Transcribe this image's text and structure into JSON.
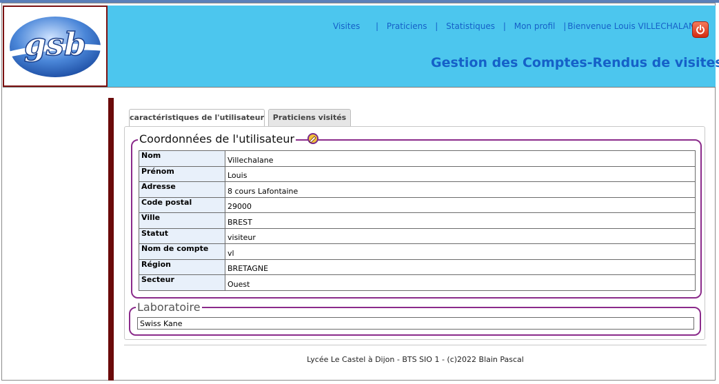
{
  "header": {
    "logo_text": "gsb",
    "nav": {
      "visites": "Visites",
      "praticiens": "Praticiens",
      "statistiques": "Statistiques",
      "mon_profil": "Mon profil",
      "welcome": "Bienvenue Louis VILLECHALANE",
      "separator": "|"
    },
    "logout_icon": "power-icon",
    "app_title": "Gestion des Comptes-Rendus de visites"
  },
  "tabs": [
    {
      "label": "caractéristiques de l'utilisateur",
      "active": true
    },
    {
      "label": "Praticiens visités",
      "active": false
    }
  ],
  "user_section": {
    "legend": "Coordonnées de l'utilisateur",
    "edit_icon": "edit-pencil-icon",
    "rows": [
      {
        "label": "Nom",
        "value": "Villechalane"
      },
      {
        "label": "Prénom",
        "value": "Louis"
      },
      {
        "label": "Adresse",
        "value": "8 cours Lafontaine"
      },
      {
        "label": "Code postal",
        "value": "29000"
      },
      {
        "label": "Ville",
        "value": "BREST"
      },
      {
        "label": "Statut",
        "value": "visiteur"
      },
      {
        "label": "Nom de compte",
        "value": "vl"
      },
      {
        "label": "Région",
        "value": "BRETAGNE"
      },
      {
        "label": "Secteur",
        "value": "Ouest"
      }
    ]
  },
  "lab_section": {
    "legend": "Laboratoire",
    "value": "Swiss Kane"
  },
  "footer": {
    "text": "Lycée Le Castel à Dijon - BTS SIO 1 - (c)2022 Blain Pascal"
  },
  "colors": {
    "header_bg": "#4cc6ee",
    "link": "#1560c8",
    "fieldset_border": "#8a2a8a",
    "sidebar_bar": "#6b0a0a"
  }
}
